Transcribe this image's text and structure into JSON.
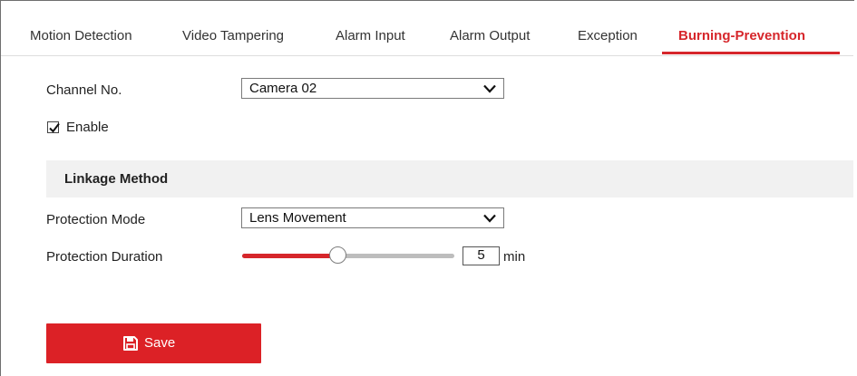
{
  "tabs": [
    {
      "label": "Motion Detection"
    },
    {
      "label": "Video Tampering"
    },
    {
      "label": "Alarm Input"
    },
    {
      "label": "Alarm Output"
    },
    {
      "label": "Exception"
    },
    {
      "label": "Burning-Prevention",
      "active": true
    }
  ],
  "form": {
    "channel_label": "Channel No.",
    "channel_value": "Camera 02",
    "enable_label": "Enable",
    "enable_checked": true,
    "linkage_title": "Linkage Method",
    "protection_mode_label": "Protection Mode",
    "protection_mode_value": "Lens Movement",
    "protection_duration_label": "Protection Duration",
    "duration_value": "5",
    "duration_unit": "min",
    "slider_level_fraction": 0.45
  },
  "actions": {
    "save_label": "Save"
  },
  "colors": {
    "accent": "#d6262b",
    "button": "#dc2126",
    "section_bg": "#f1f1f1"
  },
  "icons": {
    "save": "save-icon",
    "dropdown": "chevron-down-icon",
    "check": "checkmark-icon"
  }
}
